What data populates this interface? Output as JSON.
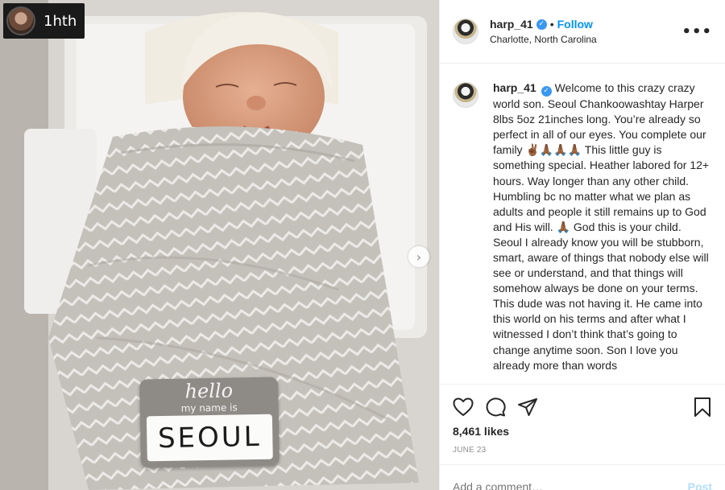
{
  "photo": {
    "badge_text": "1hth",
    "nametag_hello": "hello",
    "nametag_subtitle": "my name is",
    "nametag_name": "SEOUL",
    "next_icon": "chevron-right-icon"
  },
  "header": {
    "username": "harp_41",
    "verified_icon": "verified-badge-icon",
    "separator": "•",
    "follow_label": "Follow",
    "location": "Charlotte, North Carolina",
    "more_icon": "more-options-icon"
  },
  "caption": {
    "username": "harp_41",
    "text": "Welcome to this crazy crazy world son. Seoul Chankoowashtay Harper 8lbs 5oz 21inches long. You’re already so perfect in all of our eyes. You complete our family ✌🏾🙏🏾🙏🏾🙏🏾 This little guy is something special. Heather labored for 12+ hours. Way longer than any other child. Humbling bc no matter what we plan as adults and people it still remains up to God and His will. 🙏🏾 God this is your child. Seoul I already know you will be stubborn, smart, aware of things that nobody else will see or understand, and that things will somehow always be done on your terms. This dude was not having it. He came into this world on his terms and after what I witnessed I don’t think that’s going to change anytime soon. Son I love you already more than words"
  },
  "actions": {
    "like_icon": "heart-icon",
    "comment_icon": "comment-icon",
    "share_icon": "share-icon",
    "save_icon": "bookmark-icon",
    "likes": "8,461 likes",
    "date": "JUNE 23"
  },
  "comment": {
    "placeholder": "Add a comment…",
    "post_label": "Post"
  },
  "colors": {
    "accent": "#0095f6",
    "verified": "#3897f0",
    "muted": "#8e8e8e"
  }
}
